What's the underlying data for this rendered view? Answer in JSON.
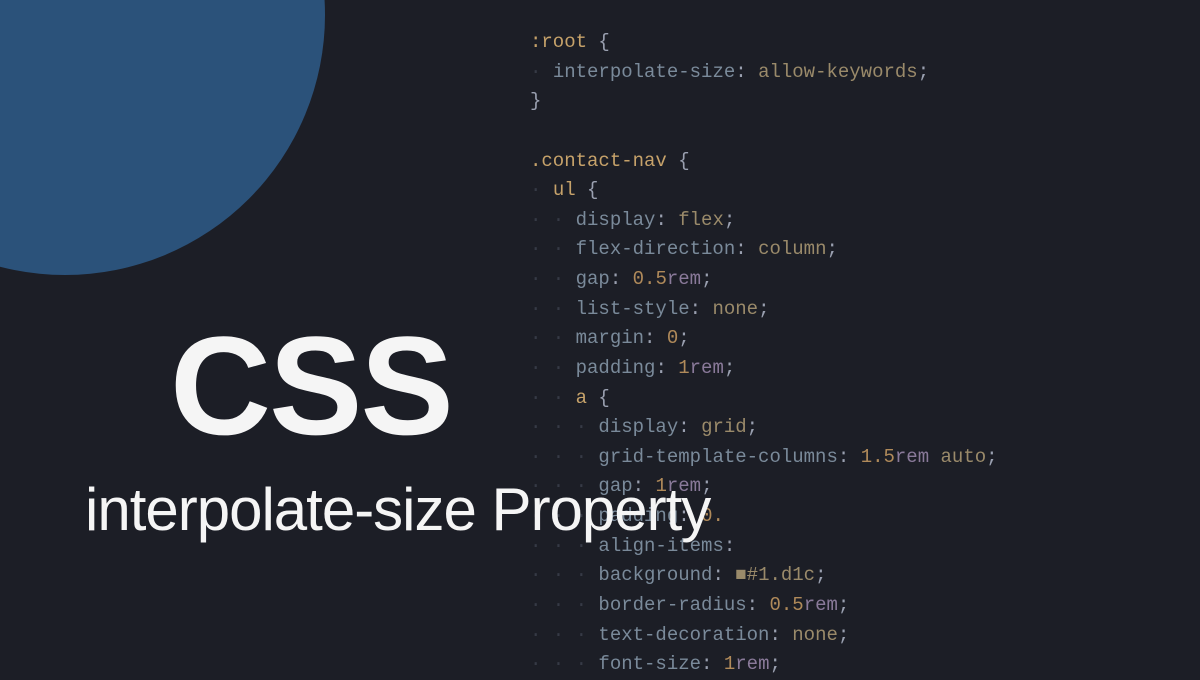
{
  "title": {
    "main": "CSS",
    "sub": "interpolate-size Property"
  },
  "code": {
    "lines": [
      {
        "indent": 0,
        "tokens": [
          {
            "t": "psel",
            "v": ":root"
          },
          {
            "t": "text",
            "v": " "
          },
          {
            "t": "brace",
            "v": "{"
          }
        ]
      },
      {
        "indent": 1,
        "tokens": [
          {
            "t": "prop",
            "v": "interpolate-size"
          },
          {
            "t": "colon",
            "v": ": "
          },
          {
            "t": "val",
            "v": "allow-keywords"
          },
          {
            "t": "semi",
            "v": ";"
          }
        ]
      },
      {
        "indent": 0,
        "tokens": [
          {
            "t": "brace",
            "v": "}"
          }
        ]
      },
      {
        "indent": 0,
        "tokens": []
      },
      {
        "indent": 0,
        "tokens": [
          {
            "t": "sel",
            "v": ".contact-nav"
          },
          {
            "t": "text",
            "v": " "
          },
          {
            "t": "brace",
            "v": "{"
          }
        ]
      },
      {
        "indent": 1,
        "tokens": [
          {
            "t": "sel",
            "v": "ul"
          },
          {
            "t": "text",
            "v": " "
          },
          {
            "t": "brace",
            "v": "{"
          }
        ]
      },
      {
        "indent": 2,
        "tokens": [
          {
            "t": "prop",
            "v": "display"
          },
          {
            "t": "colon",
            "v": ": "
          },
          {
            "t": "val",
            "v": "flex"
          },
          {
            "t": "semi",
            "v": ";"
          }
        ]
      },
      {
        "indent": 2,
        "tokens": [
          {
            "t": "prop",
            "v": "flex-direction"
          },
          {
            "t": "colon",
            "v": ": "
          },
          {
            "t": "val",
            "v": "column"
          },
          {
            "t": "semi",
            "v": ";"
          }
        ]
      },
      {
        "indent": 2,
        "tokens": [
          {
            "t": "prop",
            "v": "gap"
          },
          {
            "t": "colon",
            "v": ": "
          },
          {
            "t": "num",
            "v": "0.5"
          },
          {
            "t": "unit",
            "v": "rem"
          },
          {
            "t": "semi",
            "v": ";"
          }
        ]
      },
      {
        "indent": 2,
        "tokens": [
          {
            "t": "prop",
            "v": "list-style"
          },
          {
            "t": "colon",
            "v": ": "
          },
          {
            "t": "val",
            "v": "none"
          },
          {
            "t": "semi",
            "v": ";"
          }
        ]
      },
      {
        "indent": 2,
        "tokens": [
          {
            "t": "prop",
            "v": "margin"
          },
          {
            "t": "colon",
            "v": ": "
          },
          {
            "t": "num",
            "v": "0"
          },
          {
            "t": "semi",
            "v": ";"
          }
        ]
      },
      {
        "indent": 2,
        "tokens": [
          {
            "t": "prop",
            "v": "padding"
          },
          {
            "t": "colon",
            "v": ": "
          },
          {
            "t": "num",
            "v": "1"
          },
          {
            "t": "unit",
            "v": "rem"
          },
          {
            "t": "semi",
            "v": ";"
          }
        ]
      },
      {
        "indent": 2,
        "tokens": [
          {
            "t": "sel",
            "v": "a"
          },
          {
            "t": "text",
            "v": " "
          },
          {
            "t": "brace",
            "v": "{"
          }
        ]
      },
      {
        "indent": 3,
        "tokens": [
          {
            "t": "prop",
            "v": "display"
          },
          {
            "t": "colon",
            "v": ": "
          },
          {
            "t": "val",
            "v": "grid"
          },
          {
            "t": "semi",
            "v": ";"
          }
        ]
      },
      {
        "indent": 3,
        "tokens": [
          {
            "t": "prop",
            "v": "grid-template-columns"
          },
          {
            "t": "colon",
            "v": ": "
          },
          {
            "t": "num",
            "v": "1.5"
          },
          {
            "t": "unit",
            "v": "rem"
          },
          {
            "t": "text",
            "v": " "
          },
          {
            "t": "val",
            "v": "auto"
          },
          {
            "t": "semi",
            "v": ";"
          }
        ]
      },
      {
        "indent": 3,
        "tokens": [
          {
            "t": "prop",
            "v": "gap"
          },
          {
            "t": "colon",
            "v": ": "
          },
          {
            "t": "num",
            "v": "1"
          },
          {
            "t": "unit",
            "v": "rem"
          },
          {
            "t": "semi",
            "v": ";"
          }
        ]
      },
      {
        "indent": 3,
        "tokens": [
          {
            "t": "prop",
            "v": "padding"
          },
          {
            "t": "colon",
            "v": ": "
          },
          {
            "t": "num",
            "v": "0."
          }
        ]
      },
      {
        "indent": 3,
        "tokens": [
          {
            "t": "prop",
            "v": "align-items"
          },
          {
            "t": "colon",
            "v": ":"
          }
        ]
      },
      {
        "indent": 3,
        "tokens": [
          {
            "t": "prop",
            "v": "background"
          },
          {
            "t": "colon",
            "v": ": "
          },
          {
            "t": "val",
            "v": "■#1.d1c"
          },
          {
            "t": "semi",
            "v": ";"
          }
        ]
      },
      {
        "indent": 3,
        "tokens": [
          {
            "t": "prop",
            "v": "border-radius"
          },
          {
            "t": "colon",
            "v": ": "
          },
          {
            "t": "num",
            "v": "0.5"
          },
          {
            "t": "unit",
            "v": "rem"
          },
          {
            "t": "semi",
            "v": ";"
          }
        ]
      },
      {
        "indent": 3,
        "tokens": [
          {
            "t": "prop",
            "v": "text-decoration"
          },
          {
            "t": "colon",
            "v": ": "
          },
          {
            "t": "val",
            "v": "none"
          },
          {
            "t": "semi",
            "v": ";"
          }
        ]
      },
      {
        "indent": 3,
        "tokens": [
          {
            "t": "prop",
            "v": "font-size"
          },
          {
            "t": "colon",
            "v": ": "
          },
          {
            "t": "num",
            "v": "1"
          },
          {
            "t": "unit",
            "v": "rem"
          },
          {
            "t": "semi",
            "v": ";"
          }
        ]
      }
    ]
  },
  "colors": {
    "bg": "#1c1e26",
    "circle": "#2b527a",
    "titleText": "#f5f5f5"
  }
}
